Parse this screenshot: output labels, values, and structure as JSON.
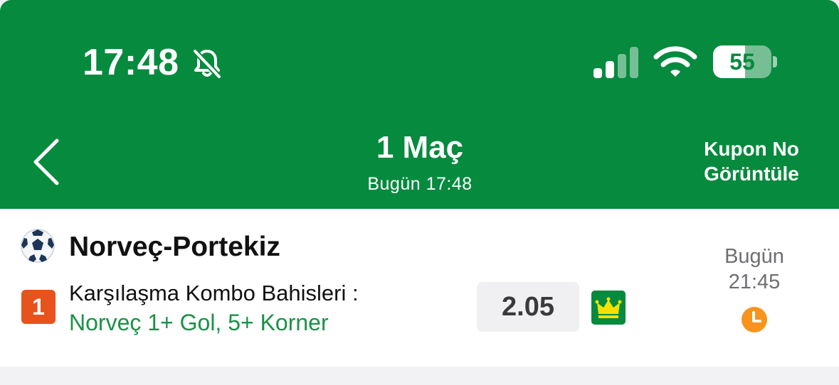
{
  "status_bar": {
    "time": "17:48",
    "battery_level": "55",
    "battery_percent": 55,
    "icons": [
      "bell-slash-icon",
      "signal-icon",
      "wifi-icon",
      "battery-icon"
    ]
  },
  "nav": {
    "back_icon": "chevron-left-icon",
    "title": "1 Maç",
    "subtitle": "Bugün 17:48",
    "coupon_line1": "Kupon No",
    "coupon_line2": "Görüntüle"
  },
  "bet": {
    "sport_icon": "soccer-ball-icon",
    "match": "Norveç-Portekiz",
    "pick_number": "1",
    "market": "Karşılaşma Kombo Bahisleri :",
    "selection": "Norveç 1+ Gol, 5+ Korner",
    "odds": "2.05",
    "badge_icon": "crown-icon",
    "date_day": "Bugün",
    "date_time": "21:45",
    "status_icon": "clock-icon"
  },
  "colors": {
    "header_green": "#068a3e",
    "selection_green": "#1a9147",
    "pick_orange": "#e8521c",
    "clock_orange": "#f7941d",
    "crown_yellow": "#f5e100"
  }
}
